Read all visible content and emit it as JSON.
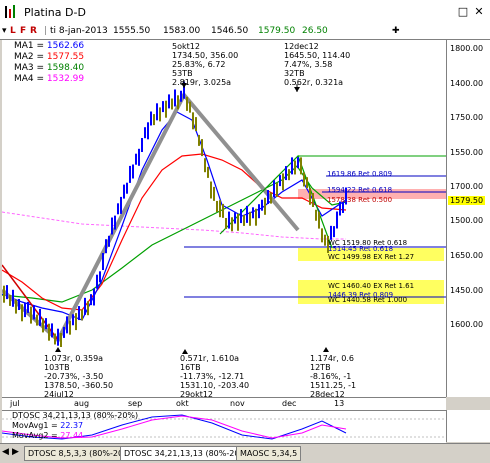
{
  "window": {
    "title": "Platina D-D",
    "maximize": "□",
    "close": "✕"
  },
  "toolbar": {
    "modes": [
      "L",
      "F",
      "R"
    ],
    "date": "ti 8-jan-2013",
    "open": "1555.50",
    "high": "1583.00",
    "low": "1546.50",
    "close": "1579.50",
    "change": "26.50",
    "crosshair": "✚"
  },
  "moving_averages": [
    {
      "label": "MA1 = ",
      "value": "1562.66",
      "color": "#0000ff"
    },
    {
      "label": "MA2 = ",
      "value": "1577.55",
      "color": "#ff0000"
    },
    {
      "label": "MA3 = ",
      "value": "1598.40",
      "color": "#008000"
    },
    {
      "label": "MA4 = ",
      "value": "1532.99",
      "color": "#ff00ff"
    }
  ],
  "annotations": {
    "peak_top": "5okt12\n1734.50, 356.00\n25.83%, 6.72\n53TB\n2.819r, 3.025a",
    "peak_right": "12dec12\n1645.50, 114.40\n7.47%, 3.58\n32TB\n0.562r, 0.321a",
    "bottom_left": "1.073r, 0.359a\n103TB\n-20.73%, -3.50\n1378.50, -360.50\n24jul12",
    "bottom_mid": "0.571r, 1.610a\n16TB\n-11.73%, -12.71\n1531.10, -203.40\n29okt12",
    "bottom_right": "1.174r, 0.6\n12TB\n-8.16%, -1\n1511.25, -1\n28dec12"
  },
  "levels": [
    {
      "label": "1619.86 Ret 0.809",
      "color": "#0000c0"
    },
    {
      "label": "1594.22 Ret 0.618",
      "color": "#0000c0"
    },
    {
      "label": "1578.38 Ret 0.500",
      "color": "#c00000"
    },
    {
      "label": "WC 1519.80 Ret 0.618",
      "color": "#000000"
    },
    {
      "label": "1514.45 Ret 0.618",
      "color": "#0000c0"
    },
    {
      "label": "WC 1499.98 EX Ret 1.27",
      "color": "#000000"
    },
    {
      "label": "WC 1460.40 EX Ret 1.61",
      "color": "#000000"
    },
    {
      "label": "1446.39 Ret 0.809",
      "color": "#0000c0"
    },
    {
      "label": "WC 1440.58 Ret 1.000",
      "color": "#000000"
    }
  ],
  "yaxis": {
    "ticks": [
      "1800.00",
      "1750.00",
      "1700.00",
      "1650.00",
      "1600.00",
      "1550.00",
      "1500.00",
      "1450.00",
      "1400.00"
    ],
    "last_price": "1579.50"
  },
  "xaxis": {
    "labels": [
      "jul",
      "aug",
      "sep",
      "okt",
      "nov",
      "dec",
      "13"
    ]
  },
  "oscillator": {
    "title": "DTOSC 34,21,13,13 (80%-20%)",
    "movavg1_label": "MovAvg1 = ",
    "movavg1_value": "22.37",
    "movavg2_label": "MovAvg2 = ",
    "movavg2_value": "27.44"
  },
  "tabs": [
    "DTOSC 8,5,3,3 (80%-20%)",
    "DTOSC 34,21,13,13 (80%-20%)",
    "MAOSC 5,34,5"
  ],
  "colors": {
    "up_bar": "#0000ff",
    "down_bar": "#808000",
    "zone_red": "#ffb0b0",
    "zone_yellow": "#ffff60",
    "pricetag": "#ffff00",
    "ma_pink": "#ff66ff"
  }
}
